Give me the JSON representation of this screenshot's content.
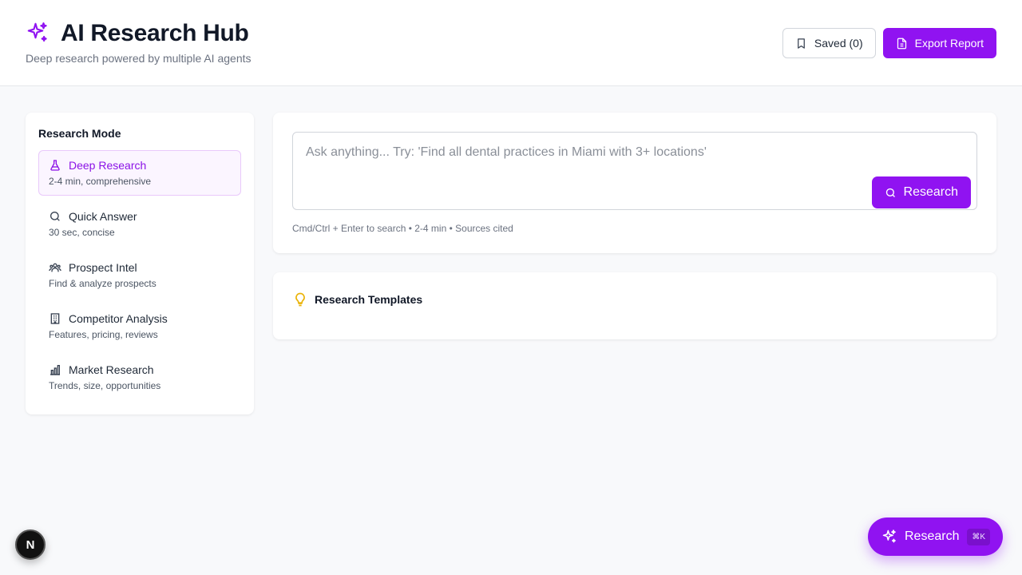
{
  "header": {
    "title": "AI Research Hub",
    "subtitle": "Deep research powered by multiple AI agents",
    "brand_icon": "sparkles-icon",
    "saved_label": "Saved (0)",
    "export_label": "Export Report"
  },
  "sidebar": {
    "title": "Research Mode",
    "items": [
      {
        "label": "Deep Research",
        "desc": "2-4 min, comprehensive",
        "icon": "flask-icon",
        "active": true
      },
      {
        "label": "Quick Answer",
        "desc": "30 sec, concise",
        "icon": "search-icon",
        "active": false
      },
      {
        "label": "Prospect Intel",
        "desc": "Find & analyze prospects",
        "icon": "users-icon",
        "active": false
      },
      {
        "label": "Competitor Analysis",
        "desc": "Features, pricing, reviews",
        "icon": "building-icon",
        "active": false
      },
      {
        "label": "Market Research",
        "desc": "Trends, size, opportunities",
        "icon": "bar-chart-icon",
        "active": false
      }
    ]
  },
  "search": {
    "placeholder": "Ask anything... Try: 'Find all dental practices in Miami with 3+ locations'",
    "value": "",
    "button_label": "Research",
    "hint": "Cmd/Ctrl + Enter to search • 2-4 min • Sources cited"
  },
  "templates": {
    "title": "Research Templates",
    "icon": "lightbulb-icon"
  },
  "fab": {
    "label": "Research",
    "shortcut": "⌘K"
  },
  "dev_badge": {
    "label": "N"
  },
  "colors": {
    "accent": "#9013f1",
    "background": "#f8f9fb",
    "active_bg": "#fbf5ff",
    "lightbulb": "#eab308"
  }
}
